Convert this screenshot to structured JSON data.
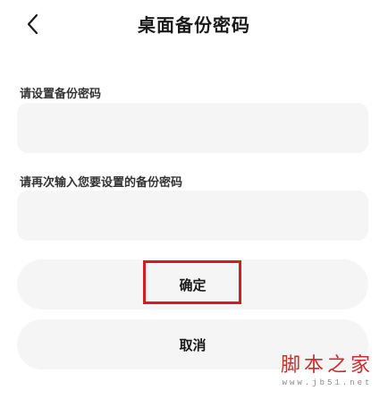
{
  "header": {
    "title": "桌面备份密码",
    "back_icon": "chevron-left-icon"
  },
  "form": {
    "password_label": "请设置备份密码",
    "password_value": "",
    "confirm_label": "请再次输入您要设置的备份密码",
    "confirm_value": ""
  },
  "actions": {
    "confirm_label": "确定",
    "cancel_label": "取消"
  },
  "annotation": {
    "highlight_color": "#d9191b"
  },
  "watermark": {
    "text_cn": "脚本之家",
    "url": "www.jb51.net"
  }
}
